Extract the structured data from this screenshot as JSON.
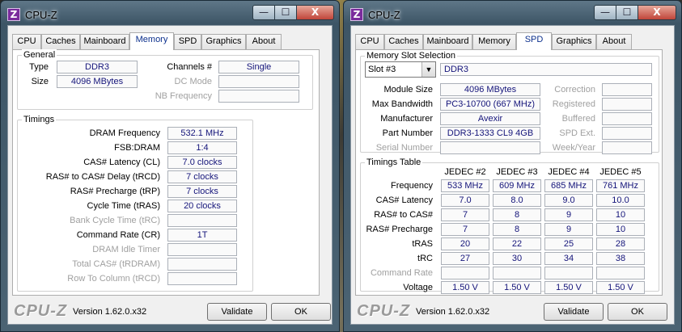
{
  "left_window": {
    "title": "CPU-Z",
    "app_icon": "Z",
    "tabs": [
      "CPU",
      "Caches",
      "Mainboard",
      "Memory",
      "SPD",
      "Graphics",
      "About"
    ],
    "active_tab": "Memory",
    "general": {
      "title": "General",
      "type_label": "Type",
      "type_value": "DDR3",
      "size_label": "Size",
      "size_value": "4096 MBytes",
      "channels_label": "Channels #",
      "channels_value": "Single",
      "dcmode_label": "DC Mode",
      "dcmode_value": "",
      "nbfreq_label": "NB Frequency",
      "nbfreq_value": ""
    },
    "timings": {
      "title": "Timings",
      "rows": [
        {
          "label": "DRAM Frequency",
          "value": "532.1 MHz",
          "dim": false
        },
        {
          "label": "FSB:DRAM",
          "value": "1:4",
          "dim": false
        },
        {
          "label": "CAS# Latency (CL)",
          "value": "7.0 clocks",
          "dim": false
        },
        {
          "label": "RAS# to CAS# Delay (tRCD)",
          "value": "7 clocks",
          "dim": false
        },
        {
          "label": "RAS# Precharge (tRP)",
          "value": "7 clocks",
          "dim": false
        },
        {
          "label": "Cycle Time (tRAS)",
          "value": "20 clocks",
          "dim": false
        },
        {
          "label": "Bank Cycle Time (tRC)",
          "value": "",
          "dim": true
        },
        {
          "label": "Command Rate (CR)",
          "value": "1T",
          "dim": false
        },
        {
          "label": "DRAM Idle Timer",
          "value": "",
          "dim": true
        },
        {
          "label": "Total CAS# (tRDRAM)",
          "value": "",
          "dim": true
        },
        {
          "label": "Row To Column (tRCD)",
          "value": "",
          "dim": true
        }
      ]
    },
    "footer": {
      "logo": "CPU-Z",
      "version": "Version 1.62.0.x32",
      "validate": "Validate",
      "ok": "OK"
    }
  },
  "right_window": {
    "title": "CPU-Z",
    "app_icon": "Z",
    "tabs": [
      "CPU",
      "Caches",
      "Mainboard",
      "Memory",
      "SPD",
      "Graphics",
      "About"
    ],
    "active_tab": "SPD",
    "slot": {
      "title": "Memory Slot Selection",
      "selected": "Slot #3",
      "type": "DDR3",
      "left_rows": [
        {
          "label": "Module Size",
          "value": "4096 MBytes",
          "dim": false
        },
        {
          "label": "Max Bandwidth",
          "value": "PC3-10700 (667 MHz)",
          "dim": false
        },
        {
          "label": "Manufacturer",
          "value": "Avexir",
          "dim": false
        },
        {
          "label": "Part Number",
          "value": "DDR3-1333 CL9 4GB",
          "dim": false
        },
        {
          "label": "Serial Number",
          "value": "",
          "dim": true
        }
      ],
      "right_rows": [
        {
          "label": "Correction",
          "value": ""
        },
        {
          "label": "Registered",
          "value": ""
        },
        {
          "label": "Buffered",
          "value": ""
        },
        {
          "label": "SPD Ext.",
          "value": ""
        },
        {
          "label": "Week/Year",
          "value": ""
        }
      ]
    },
    "timings_table": {
      "title": "Timings Table",
      "columns": [
        "JEDEC #2",
        "JEDEC #3",
        "JEDEC #4",
        "JEDEC #5"
      ],
      "rows": [
        {
          "label": "Frequency",
          "values": [
            "533 MHz",
            "609 MHz",
            "685 MHz",
            "761 MHz"
          ],
          "dim": false
        },
        {
          "label": "CAS# Latency",
          "values": [
            "7.0",
            "8.0",
            "9.0",
            "10.0"
          ],
          "dim": false
        },
        {
          "label": "RAS# to CAS#",
          "values": [
            "7",
            "8",
            "9",
            "10"
          ],
          "dim": false
        },
        {
          "label": "RAS# Precharge",
          "values": [
            "7",
            "8",
            "9",
            "10"
          ],
          "dim": false
        },
        {
          "label": "tRAS",
          "values": [
            "20",
            "22",
            "25",
            "28"
          ],
          "dim": false
        },
        {
          "label": "tRC",
          "values": [
            "27",
            "30",
            "34",
            "38"
          ],
          "dim": false
        },
        {
          "label": "Command Rate",
          "values": [
            "",
            "",
            "",
            ""
          ],
          "dim": true
        },
        {
          "label": "Voltage",
          "values": [
            "1.50 V",
            "1.50 V",
            "1.50 V",
            "1.50 V"
          ],
          "dim": false
        }
      ]
    },
    "footer": {
      "logo": "CPU-Z",
      "version": "Version 1.62.0.x32",
      "validate": "Validate",
      "ok": "OK"
    }
  },
  "window_controls": {
    "minimize": "—",
    "maximize": "☐",
    "close": "X"
  }
}
